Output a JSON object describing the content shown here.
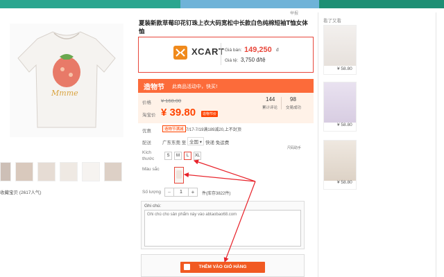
{
  "product": {
    "title": "夏装新款草莓印花钉珠上衣大码宽松中长款白色纯棉短袖T恤女体恤",
    "report_label": "举报",
    "favorites": "收藏宝贝 (2617人气)"
  },
  "xcart": {
    "logo_text": "XCART",
    "price_label": "Giá bán:",
    "price_value": "149,250",
    "price_unit": "đ",
    "rate_label": "Giá tệ:",
    "rate_value": "3,750 đ/tệ"
  },
  "promo": {
    "badge": "造物节",
    "text": "此商品活动中，快买!"
  },
  "pricing": {
    "orig_label": "价格",
    "orig_value": "¥ 168.00",
    "now_label": "淘宝价",
    "now_value": "¥ 39.80",
    "now_tag": "造物节价",
    "stat1_num": "144",
    "stat1_label": "累计评论",
    "stat2_num": "98",
    "stat2_label": "交易成功"
  },
  "discount": {
    "label": "优惠",
    "tag": "造物节满减",
    "text": "7/17-7/19满189减20,上不封顶"
  },
  "shipping": {
    "label": "配送",
    "from": "广东东莞 至",
    "dest": "全国 ▾",
    "method": "快递 免运费",
    "feature": "尺码助手"
  },
  "size": {
    "label": "Kích thước",
    "options": [
      "S",
      "M",
      "L",
      "XL"
    ],
    "selected": "L"
  },
  "color": {
    "label": "Màu sắc"
  },
  "quantity": {
    "label": "Số lượng",
    "minus": "−",
    "value": "1",
    "plus": "+",
    "stock": "件(库存3822件)"
  },
  "note": {
    "label": "Ghi chú:",
    "placeholder": "Ghi chú cho sản phẩm này vào abtaobao68.com"
  },
  "cart": {
    "label": "THÊM VÀO GIỎ HÀNG"
  },
  "sidebar": {
    "title": "看了又看",
    "items": [
      {
        "price": "¥ 58.80"
      },
      {
        "price": "¥ 58.80"
      },
      {
        "price": "¥ 58.80"
      }
    ]
  },
  "colors": {
    "accent": "#e8463a",
    "promo": "#fc6b3a",
    "price": "#ff4400",
    "cart": "#f15a22"
  }
}
